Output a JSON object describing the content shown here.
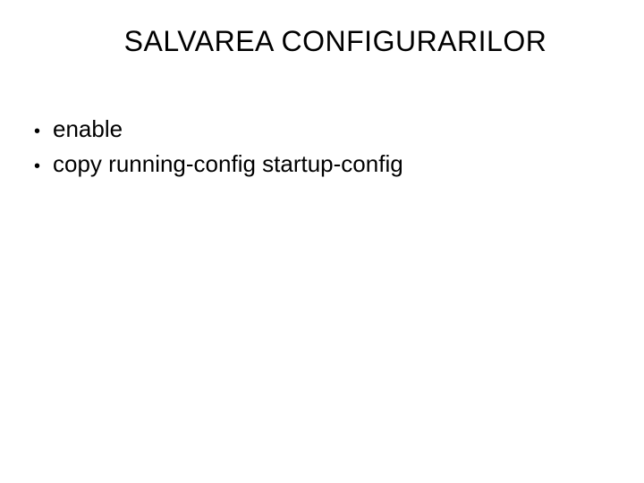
{
  "slide": {
    "title": "SALVAREA CONFIGURARILOR",
    "bullets": [
      "enable",
      "copy running-config startup-config"
    ]
  }
}
